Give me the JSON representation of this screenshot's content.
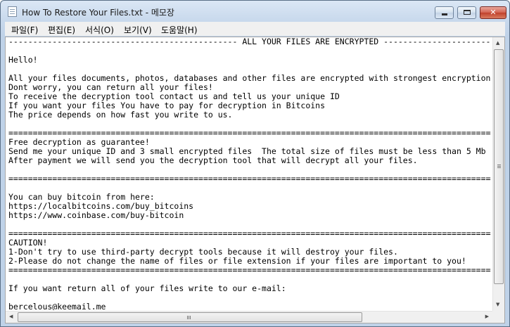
{
  "window": {
    "title": "How To Restore Your Files.txt - 메모장",
    "close_symbol": "✕"
  },
  "menu": {
    "items": [
      {
        "label": "파일(F)"
      },
      {
        "label": "편집(E)"
      },
      {
        "label": "서식(O)"
      },
      {
        "label": "보기(V)"
      },
      {
        "label": "도움말(H)"
      }
    ]
  },
  "document": {
    "lines": [
      "----------------------------------------------- ALL YOUR FILES ARE ENCRYPTED -----------------------------------------------",
      "",
      "Hello!",
      "",
      "All your files documents, photos, databases and other files are encrypted with strongest encryption",
      "Dont worry, you can return all your files!",
      "To receive the decryption tool contact us and tell us your unique ID",
      "If you want your files You have to pay for decryption in Bitcoins",
      "The price depends on how fast you write to us.",
      "",
      "====================================================================================================",
      "Free decryption as guarantee!",
      "Send me your unique ID and 3 small encrypted files  The total size of files must be less than 5 Mb",
      "After payment we will send you the decryption tool that will decrypt all your files.",
      "",
      "====================================================================================================",
      "",
      "You can buy bitcoin from here:",
      "https://localbitcoins.com/buy_bitcoins",
      "https://www.coinbase.com/buy-bitcoin",
      "",
      "====================================================================================================",
      "CAUTION!",
      "1-Don't try to use third-party decrypt tools because it will destroy your files.",
      "2-Please do not change the name of files or file extension if your files are important to you!",
      "====================================================================================================",
      "",
      "If you want return all of your files write to our e-mail:",
      "",
      "bercelous@keemail.me"
    ]
  },
  "scrollbars": {
    "up_symbol": "▲",
    "down_symbol": "▼",
    "left_symbol": "◀",
    "right_symbol": "▶"
  }
}
